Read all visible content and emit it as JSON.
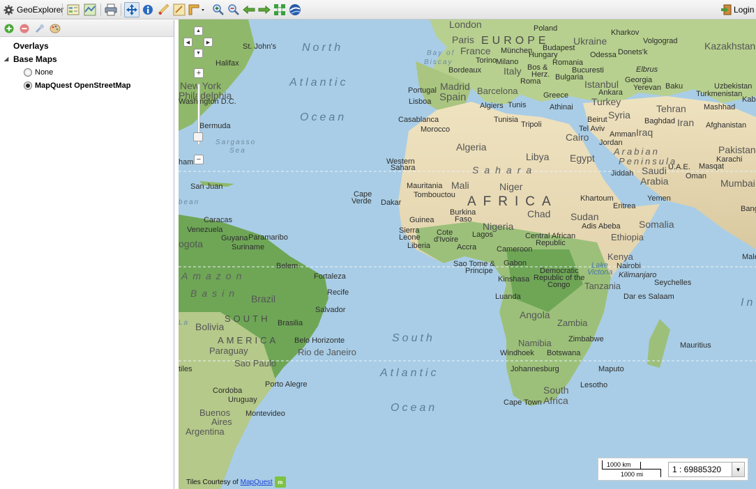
{
  "toolbar": {
    "app_title": "GeoExplorer",
    "login_label": "Login"
  },
  "panel": {
    "tree": {
      "overlays": "Overlays",
      "base_maps": "Base Maps",
      "layers": [
        {
          "label": "None",
          "selected": false
        },
        {
          "label": "MapQuest OpenStreetMap",
          "selected": true
        }
      ]
    }
  },
  "map": {
    "labels": {
      "london": "London",
      "paris": "Paris",
      "france": "France",
      "europe": "EUROPE",
      "poland": "Poland",
      "kharkov": "Kharkov",
      "volgograd": "Volgograd",
      "kazakhstan": "Kazakhstan",
      "ukraine": "Ukraine",
      "budapest": "Budapest",
      "munchen": "München",
      "hungary": "Hungary",
      "odessa": "Odessa",
      "donetsk": "Donets'k",
      "elbrus": "Elbrus",
      "romania": "Romania",
      "bucuresti": "Bucuresti",
      "torino": "Torino",
      "milano": "Milano",
      "bordeaux": "Bordeaux",
      "italy": "Italy",
      "bosnia": "Bos &",
      "herz": "Herz.",
      "bulgaria": "Bulgaria",
      "istanbul": "Istanbul",
      "georgia": "Georgia",
      "yerevan": "Yerevan",
      "baku": "Baku",
      "uzbekistan": "Uzbekistan",
      "turkmenistan": "Turkmenistan",
      "madrid": "Madrid",
      "spain": "Spain",
      "portugal": "Portugal",
      "lisboa": "Lisboa",
      "barcelona": "Barcelona",
      "roma": "Roma",
      "greece": "Greece",
      "ankara": "Ankara",
      "turkey": "Turkey",
      "athinai": "Athinai",
      "tehran": "Tehran",
      "mashhad": "Mashhad",
      "algiers": "Algiers",
      "tunis": "Tunis",
      "syria": "Syria",
      "beirut": "Beirut",
      "baghdad": "Baghdad",
      "iran": "Iran",
      "afghanistan": "Afghanistan",
      "casablanca": "Casablanca",
      "tunisia": "Tunisia",
      "tripoli": "Tripoli",
      "morocco": "Morocco",
      "tel_aviv": "Tel Aviv",
      "amman": "Amman",
      "iraq": "Iraq",
      "cairo": "Cairo",
      "jordan": "Jordan",
      "arabian": "Arabian",
      "peninsula": "Peninsula",
      "pakistan": "Pakistan",
      "karachi": "Karachi",
      "algeria": "Algeria",
      "libya": "Libya",
      "egypt": "Egypt",
      "western": "Western",
      "sahara_w": "Sahara",
      "sahara": "Sahara",
      "jiddah": "Jiddah",
      "saudi": "Saudi",
      "arabia": "Arabia",
      "uae": "U.A.E.",
      "masqat": "Masqat",
      "oman": "Oman",
      "mumbai": "Mumbai",
      "mauritania": "Mauritania",
      "mali": "Mali",
      "niger": "Niger",
      "tombouctou": "Tombouctou",
      "yemen": "Yemen",
      "cape": "Cape",
      "verde": "Verde",
      "dakar": "Dakar",
      "africa": "AFRICA",
      "khartoum": "Khartoum",
      "chad": "Chad",
      "sudan": "Sudan",
      "eritrea": "Eritrea",
      "burkina": "Burkina",
      "faso": "Faso",
      "guinea": "Guinea",
      "nigeria": "Nigeria",
      "adis_abeba": "Adis Abeba",
      "somalia": "Somalia",
      "sierra": "Sierra",
      "leone": "Leone",
      "cote": "Cote",
      "divoire": "d'Ivoire",
      "liberia": "Liberia",
      "lagos": "Lagos",
      "accra": "Accra",
      "car1": "Central African",
      "car2": "Republic",
      "cameroon": "Cameroon",
      "ethiopia": "Ethiopia",
      "kenya": "Kenya",
      "nairobi": "Nairobi",
      "kilimanjaro": "Kilimanjaro",
      "sao_tome": "Sao Tome &",
      "principe": "Principe",
      "gabon": "Gabon",
      "drc1": "Democratic",
      "drc2": "Republic of the",
      "drc3": "Congo",
      "kinshasa": "Kinshasa",
      "lake": "Lake",
      "victoria": "Victoria",
      "tanzania": "Tanzania",
      "seychelles": "Seychelles",
      "luanda": "Luanda",
      "dar": "Dar es Salaam",
      "angola": "Angola",
      "zambia": "Zambia",
      "zimbabwe": "Zimbabwe",
      "namibia": "Namibia",
      "windhoek": "Windhoek",
      "botswana": "Botswana",
      "mauritius": "Mauritius",
      "johannesburg": "Johannesburg",
      "maputo": "Maputo",
      "south1": "South",
      "africa2": "Africa",
      "lesotho": "Lesotho",
      "cape_town": "Cape Town",
      "north": "North",
      "atlantic": "Atlantic",
      "ocean": "Ocean",
      "south_o": "South",
      "atlantic_s": "Atlantic",
      "ocean_s": "Ocean",
      "bay_of": "Bay of",
      "biscay": "Biscay",
      "sargasso": "Sargasso",
      "sea": "Sea",
      "st_johns": "St. John's",
      "halifax": "Halifax",
      "new_york": "New York",
      "philadelphia": "Philadelphia",
      "washington": "Washington D.C.",
      "bermuda": "Bermuda",
      "bahamas": "ham",
      "san_juan": "San Juan",
      "bean": "bean",
      "caracas": "Caracas",
      "venezuela": "Venezuela",
      "guyana": "Guyana",
      "paramaribo": "Paramaribo",
      "suriname": "Suriname",
      "colombia": "ogota",
      "belem": "Belem",
      "fortaleza": "Fortaleza",
      "amazon": "Amazon",
      "basin": "Basin",
      "recife": "Recife",
      "brazil": "Brazil",
      "salvador": "Salvador",
      "south_am": "SOUTH",
      "america": "AMERICA",
      "bolivia": "Bolivia",
      "brasilia": "Brasilia",
      "la_paz": "La",
      "belo": "Belo Horizonte",
      "paraguay": "Paraguay",
      "rio": "Rio de Janeiro",
      "sao_paulo": "Sao Paulo",
      "tiles": "tiles",
      "porto_alegre": "Porto Alegre",
      "cordoba": "Cordoba",
      "uruguay": "Uruguay",
      "buenos": "Buenos",
      "aires": "Aires",
      "montevideo": "Montevideo",
      "argentina": "Argentina",
      "bang": "Bang",
      "in": "In",
      "kabul": "Kabul",
      "mal": "Male"
    },
    "attribution_prefix": "Tiles Courtesy of",
    "attribution_link": "MapQuest",
    "scale_km": "1000 km",
    "scale_mi": "1000 mi",
    "scale_value": "1 : 69885320"
  },
  "colors": {
    "ocean": "#a9cde6",
    "land_green": "#9cc07a",
    "desert": "#e9dcb8",
    "link": "#1a3fd6"
  }
}
